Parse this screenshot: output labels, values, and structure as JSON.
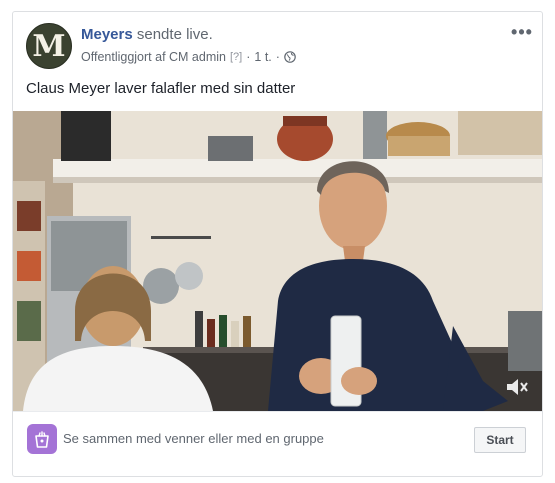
{
  "post": {
    "avatar_letter": "M",
    "page_name": "Meyers",
    "action_text": "sendte live.",
    "published_by": "Offentliggjort af CM admin",
    "help_marker": "[?]",
    "separator": "·",
    "time_ago": "1 t.",
    "separator2": "·",
    "privacy_icon": "globe-icon",
    "more_icon": "ellipsis-icon",
    "more_label": "•••",
    "text": "Claus Meyer laver falafler med sin datter"
  },
  "video": {
    "description_icon": "volume-muted-icon"
  },
  "footer": {
    "icon": "watch-party-icon",
    "invite_text": "Se sammen med venner eller med en gruppe",
    "start_label": "Start"
  },
  "colors": {
    "page_name": "#365899",
    "party_icon_bg": "#a473d6",
    "border": "#dddfe2"
  }
}
